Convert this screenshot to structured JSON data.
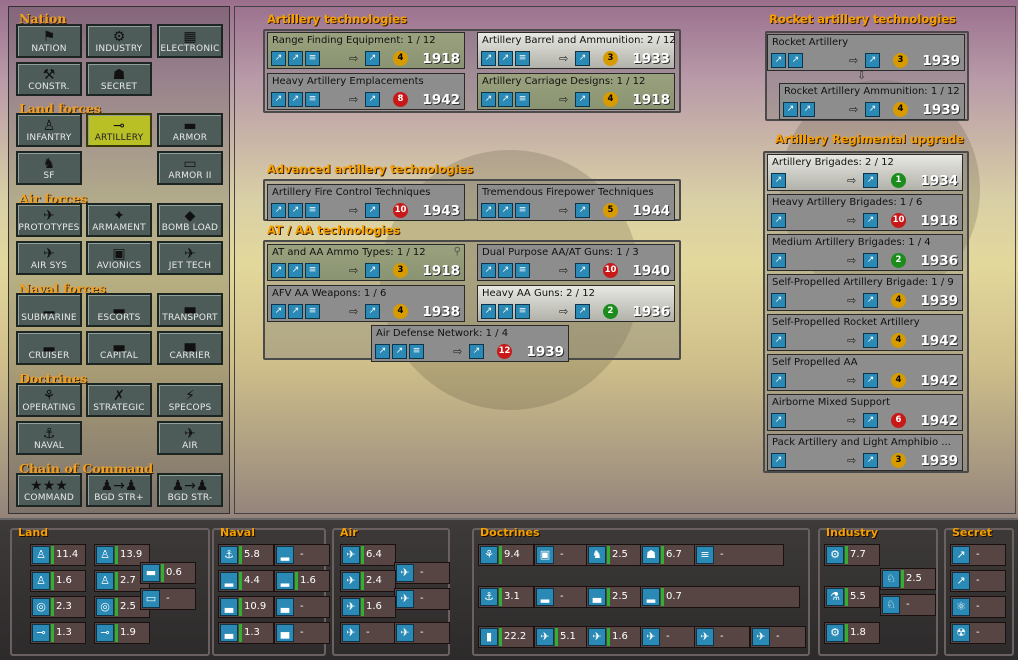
{
  "nav": {
    "sections": [
      {
        "key": "nation",
        "title": "Nation"
      },
      {
        "key": "land",
        "title": "Land forces"
      },
      {
        "key": "air",
        "title": "Air forces"
      },
      {
        "key": "naval",
        "title": "Naval forces"
      },
      {
        "key": "doctrines",
        "title": "Doctrines"
      },
      {
        "key": "coc",
        "title": "Chain of Command"
      }
    ],
    "buttons": [
      {
        "id": "nation",
        "label": "NATION",
        "icon": "⚑"
      },
      {
        "id": "industry",
        "label": "INDUSTRY",
        "icon": "⚙"
      },
      {
        "id": "electronic",
        "label": "ELECTRONIC",
        "icon": "▦"
      },
      {
        "id": "constr",
        "label": "CONSTR.",
        "icon": "⚒"
      },
      {
        "id": "secret",
        "label": "SECRET",
        "icon": "☗"
      },
      {
        "id": "infantry",
        "label": "INFANTRY",
        "icon": "♙"
      },
      {
        "id": "artillery",
        "label": "ARTILLERY",
        "icon": "⊸",
        "selected": true
      },
      {
        "id": "armor",
        "label": "ARMOR",
        "icon": "▬"
      },
      {
        "id": "sf",
        "label": "SF",
        "icon": "♞"
      },
      {
        "id": "armor2",
        "label": "ARMOR II",
        "icon": "▭"
      },
      {
        "id": "prototypes",
        "label": "PROTOTYPES",
        "icon": "✈"
      },
      {
        "id": "armament",
        "label": "ARMAMENT",
        "icon": "✦"
      },
      {
        "id": "bombload",
        "label": "BOMB LOAD",
        "icon": "◆"
      },
      {
        "id": "airsys",
        "label": "AIR SYS",
        "icon": "✈"
      },
      {
        "id": "avionics",
        "label": "AVIONICS",
        "icon": "▣"
      },
      {
        "id": "jettech",
        "label": "JET TECH",
        "icon": "✈"
      },
      {
        "id": "submarine",
        "label": "SUBMARINE",
        "icon": "▁"
      },
      {
        "id": "escorts",
        "label": "ESCORTS",
        "icon": "▂"
      },
      {
        "id": "transport",
        "label": "TRANSPORT",
        "icon": "▃"
      },
      {
        "id": "cruiser",
        "label": "CRUISER",
        "icon": "▂"
      },
      {
        "id": "capital",
        "label": "CAPITAL",
        "icon": "▃"
      },
      {
        "id": "carrier",
        "label": "CARRIER",
        "icon": "▄"
      },
      {
        "id": "operating",
        "label": "OPERATING",
        "icon": "⚘"
      },
      {
        "id": "strategic",
        "label": "STRATEGIC",
        "icon": "✗"
      },
      {
        "id": "specops",
        "label": "SPECOPS",
        "icon": "⚡"
      },
      {
        "id": "navaldoc",
        "label": "NAVAL",
        "icon": "⚓"
      },
      {
        "id": "airdoc",
        "label": "AIR",
        "icon": "✈"
      },
      {
        "id": "command",
        "label": "COMMAND",
        "icon": "★★★"
      },
      {
        "id": "bgdplus",
        "label": "BGD STR+",
        "icon": "♟→♟"
      },
      {
        "id": "bgdminus",
        "label": "BGD STR-",
        "icon": "♟→♟"
      }
    ]
  },
  "headers": {
    "artillery": "Artillery technologies",
    "advanced": "Advanced artillery technologies",
    "ataa": "AT / AA technologies",
    "rocket": "Rocket artillery technologies",
    "regimental": "Artillery Regimental upgrade"
  },
  "techs": [
    {
      "name": "Range Finding Equipment: 1 / 12",
      "cost": "4",
      "cc": "o",
      "year": "1918",
      "style": "g"
    },
    {
      "name": "Artillery Barrel and Ammunition: 2 / 12",
      "cost": "3",
      "cc": "o",
      "year": "1933",
      "style": "l"
    },
    {
      "name": "Heavy Artillery Emplacements",
      "cost": "8",
      "cc": "r",
      "year": "1942",
      "style": "n"
    },
    {
      "name": "Artillery Carriage Designs: 1 / 12",
      "cost": "4",
      "cc": "o",
      "year": "1918",
      "style": "g"
    },
    {
      "name": "Artillery Fire Control Techniques",
      "cost": "10",
      "cc": "r",
      "year": "1943",
      "style": "n"
    },
    {
      "name": "Tremendous Firepower Techniques",
      "cost": "5",
      "cc": "o",
      "year": "1944",
      "style": "n"
    },
    {
      "name": "AT and AA Ammo Types: 1 / 12",
      "cost": "3",
      "cc": "o",
      "year": "1918",
      "style": "g"
    },
    {
      "name": "Dual Purpose AA/AT Guns: 1 / 3",
      "cost": "10",
      "cc": "r",
      "year": "1940",
      "style": "n"
    },
    {
      "name": "AFV AA Weapons: 1 / 6",
      "cost": "4",
      "cc": "o",
      "year": "1938",
      "style": "n"
    },
    {
      "name": "Heavy AA Guns: 2 / 12",
      "cost": "2",
      "cc": "gn",
      "year": "1936",
      "style": "l"
    },
    {
      "name": "Air Defense Network: 1 / 4",
      "cost": "12",
      "cc": "r",
      "year": "1939",
      "style": "n"
    },
    {
      "name": "Rocket Artillery",
      "cost": "3",
      "cc": "o",
      "year": "1939",
      "style": "n"
    },
    {
      "name": "Rocket Artillery Ammunition: 1 / 12",
      "cost": "4",
      "cc": "o",
      "year": "1939",
      "style": "n"
    },
    {
      "name": "Artillery Brigades: 2 / 12",
      "cost": "1",
      "cc": "gn",
      "year": "1934",
      "style": "l"
    },
    {
      "name": "Heavy Artillery Brigades: 1 / 6",
      "cost": "10",
      "cc": "r",
      "year": "1918",
      "style": "n"
    },
    {
      "name": "Medium Artillery Brigades: 1 / 4",
      "cost": "2",
      "cc": "gn",
      "year": "1936",
      "style": "n"
    },
    {
      "name": "Self-Propelled Artillery Brigade: 1 / 9",
      "cost": "4",
      "cc": "o",
      "year": "1939",
      "style": "n"
    },
    {
      "name": "Self-Propelled Rocket Artillery",
      "cost": "4",
      "cc": "o",
      "year": "1942",
      "style": "n"
    },
    {
      "name": "Self Propelled AA",
      "cost": "4",
      "cc": "o",
      "year": "1942",
      "style": "n"
    },
    {
      "name": "Airborne Mixed Support",
      "cost": "6",
      "cc": "r",
      "year": "1942",
      "style": "n"
    },
    {
      "name": "Pack Artillery and Light Amphibio ...",
      "cost": "3",
      "cc": "o",
      "year": "1939",
      "style": "n"
    }
  ],
  "bottom": {
    "panels": [
      "Land",
      "Naval",
      "Air",
      "Doctrines",
      "Industry",
      "Secret"
    ],
    "land": [
      "11.4",
      "13.9",
      "1.6",
      "2.7",
      "2.3",
      "2.5",
      "1.3",
      "1.9",
      "0.6",
      "-"
    ],
    "naval": [
      "5.8",
      "-",
      "4.4",
      "1.6",
      "10.9",
      "-",
      "1.3",
      "-"
    ],
    "air": [
      "6.4",
      "-",
      "2.4",
      "-",
      "1.6",
      "-",
      "-"
    ],
    "doctrines": [
      "9.4",
      "-",
      "2.5",
      "6.7",
      "-",
      "3.1",
      "-",
      "2.5",
      "0.7",
      "22.2",
      "5.1",
      "1.6",
      "-",
      "-",
      "-"
    ],
    "industry": [
      "7.7",
      "2.5",
      "5.5",
      "-",
      "1.8"
    ],
    "secret": [
      "-",
      "-",
      "-",
      "-"
    ]
  }
}
